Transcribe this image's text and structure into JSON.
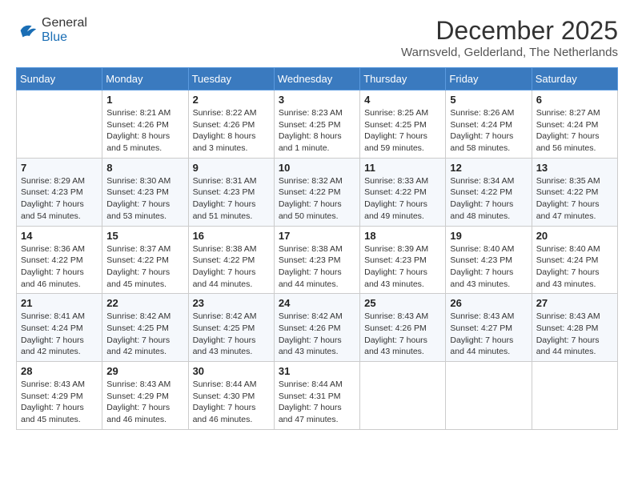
{
  "header": {
    "logo": {
      "line1": "General",
      "line2": "Blue"
    },
    "title": "December 2025",
    "subtitle": "Warnsveld, Gelderland, The Netherlands"
  },
  "calendar": {
    "days_of_week": [
      "Sunday",
      "Monday",
      "Tuesday",
      "Wednesday",
      "Thursday",
      "Friday",
      "Saturday"
    ],
    "weeks": [
      [
        {
          "day": "",
          "info": ""
        },
        {
          "day": "1",
          "info": "Sunrise: 8:21 AM\nSunset: 4:26 PM\nDaylight: 8 hours\nand 5 minutes."
        },
        {
          "day": "2",
          "info": "Sunrise: 8:22 AM\nSunset: 4:26 PM\nDaylight: 8 hours\nand 3 minutes."
        },
        {
          "day": "3",
          "info": "Sunrise: 8:23 AM\nSunset: 4:25 PM\nDaylight: 8 hours\nand 1 minute."
        },
        {
          "day": "4",
          "info": "Sunrise: 8:25 AM\nSunset: 4:25 PM\nDaylight: 7 hours\nand 59 minutes."
        },
        {
          "day": "5",
          "info": "Sunrise: 8:26 AM\nSunset: 4:24 PM\nDaylight: 7 hours\nand 58 minutes."
        },
        {
          "day": "6",
          "info": "Sunrise: 8:27 AM\nSunset: 4:24 PM\nDaylight: 7 hours\nand 56 minutes."
        }
      ],
      [
        {
          "day": "7",
          "info": "Sunrise: 8:29 AM\nSunset: 4:23 PM\nDaylight: 7 hours\nand 54 minutes."
        },
        {
          "day": "8",
          "info": "Sunrise: 8:30 AM\nSunset: 4:23 PM\nDaylight: 7 hours\nand 53 minutes."
        },
        {
          "day": "9",
          "info": "Sunrise: 8:31 AM\nSunset: 4:23 PM\nDaylight: 7 hours\nand 51 minutes."
        },
        {
          "day": "10",
          "info": "Sunrise: 8:32 AM\nSunset: 4:22 PM\nDaylight: 7 hours\nand 50 minutes."
        },
        {
          "day": "11",
          "info": "Sunrise: 8:33 AM\nSunset: 4:22 PM\nDaylight: 7 hours\nand 49 minutes."
        },
        {
          "day": "12",
          "info": "Sunrise: 8:34 AM\nSunset: 4:22 PM\nDaylight: 7 hours\nand 48 minutes."
        },
        {
          "day": "13",
          "info": "Sunrise: 8:35 AM\nSunset: 4:22 PM\nDaylight: 7 hours\nand 47 minutes."
        }
      ],
      [
        {
          "day": "14",
          "info": "Sunrise: 8:36 AM\nSunset: 4:22 PM\nDaylight: 7 hours\nand 46 minutes."
        },
        {
          "day": "15",
          "info": "Sunrise: 8:37 AM\nSunset: 4:22 PM\nDaylight: 7 hours\nand 45 minutes."
        },
        {
          "day": "16",
          "info": "Sunrise: 8:38 AM\nSunset: 4:22 PM\nDaylight: 7 hours\nand 44 minutes."
        },
        {
          "day": "17",
          "info": "Sunrise: 8:38 AM\nSunset: 4:23 PM\nDaylight: 7 hours\nand 44 minutes."
        },
        {
          "day": "18",
          "info": "Sunrise: 8:39 AM\nSunset: 4:23 PM\nDaylight: 7 hours\nand 43 minutes."
        },
        {
          "day": "19",
          "info": "Sunrise: 8:40 AM\nSunset: 4:23 PM\nDaylight: 7 hours\nand 43 minutes."
        },
        {
          "day": "20",
          "info": "Sunrise: 8:40 AM\nSunset: 4:24 PM\nDaylight: 7 hours\nand 43 minutes."
        }
      ],
      [
        {
          "day": "21",
          "info": "Sunrise: 8:41 AM\nSunset: 4:24 PM\nDaylight: 7 hours\nand 42 minutes."
        },
        {
          "day": "22",
          "info": "Sunrise: 8:42 AM\nSunset: 4:25 PM\nDaylight: 7 hours\nand 42 minutes."
        },
        {
          "day": "23",
          "info": "Sunrise: 8:42 AM\nSunset: 4:25 PM\nDaylight: 7 hours\nand 43 minutes."
        },
        {
          "day": "24",
          "info": "Sunrise: 8:42 AM\nSunset: 4:26 PM\nDaylight: 7 hours\nand 43 minutes."
        },
        {
          "day": "25",
          "info": "Sunrise: 8:43 AM\nSunset: 4:26 PM\nDaylight: 7 hours\nand 43 minutes."
        },
        {
          "day": "26",
          "info": "Sunrise: 8:43 AM\nSunset: 4:27 PM\nDaylight: 7 hours\nand 44 minutes."
        },
        {
          "day": "27",
          "info": "Sunrise: 8:43 AM\nSunset: 4:28 PM\nDaylight: 7 hours\nand 44 minutes."
        }
      ],
      [
        {
          "day": "28",
          "info": "Sunrise: 8:43 AM\nSunset: 4:29 PM\nDaylight: 7 hours\nand 45 minutes."
        },
        {
          "day": "29",
          "info": "Sunrise: 8:43 AM\nSunset: 4:29 PM\nDaylight: 7 hours\nand 46 minutes."
        },
        {
          "day": "30",
          "info": "Sunrise: 8:44 AM\nSunset: 4:30 PM\nDaylight: 7 hours\nand 46 minutes."
        },
        {
          "day": "31",
          "info": "Sunrise: 8:44 AM\nSunset: 4:31 PM\nDaylight: 7 hours\nand 47 minutes."
        },
        {
          "day": "",
          "info": ""
        },
        {
          "day": "",
          "info": ""
        },
        {
          "day": "",
          "info": ""
        }
      ]
    ]
  }
}
